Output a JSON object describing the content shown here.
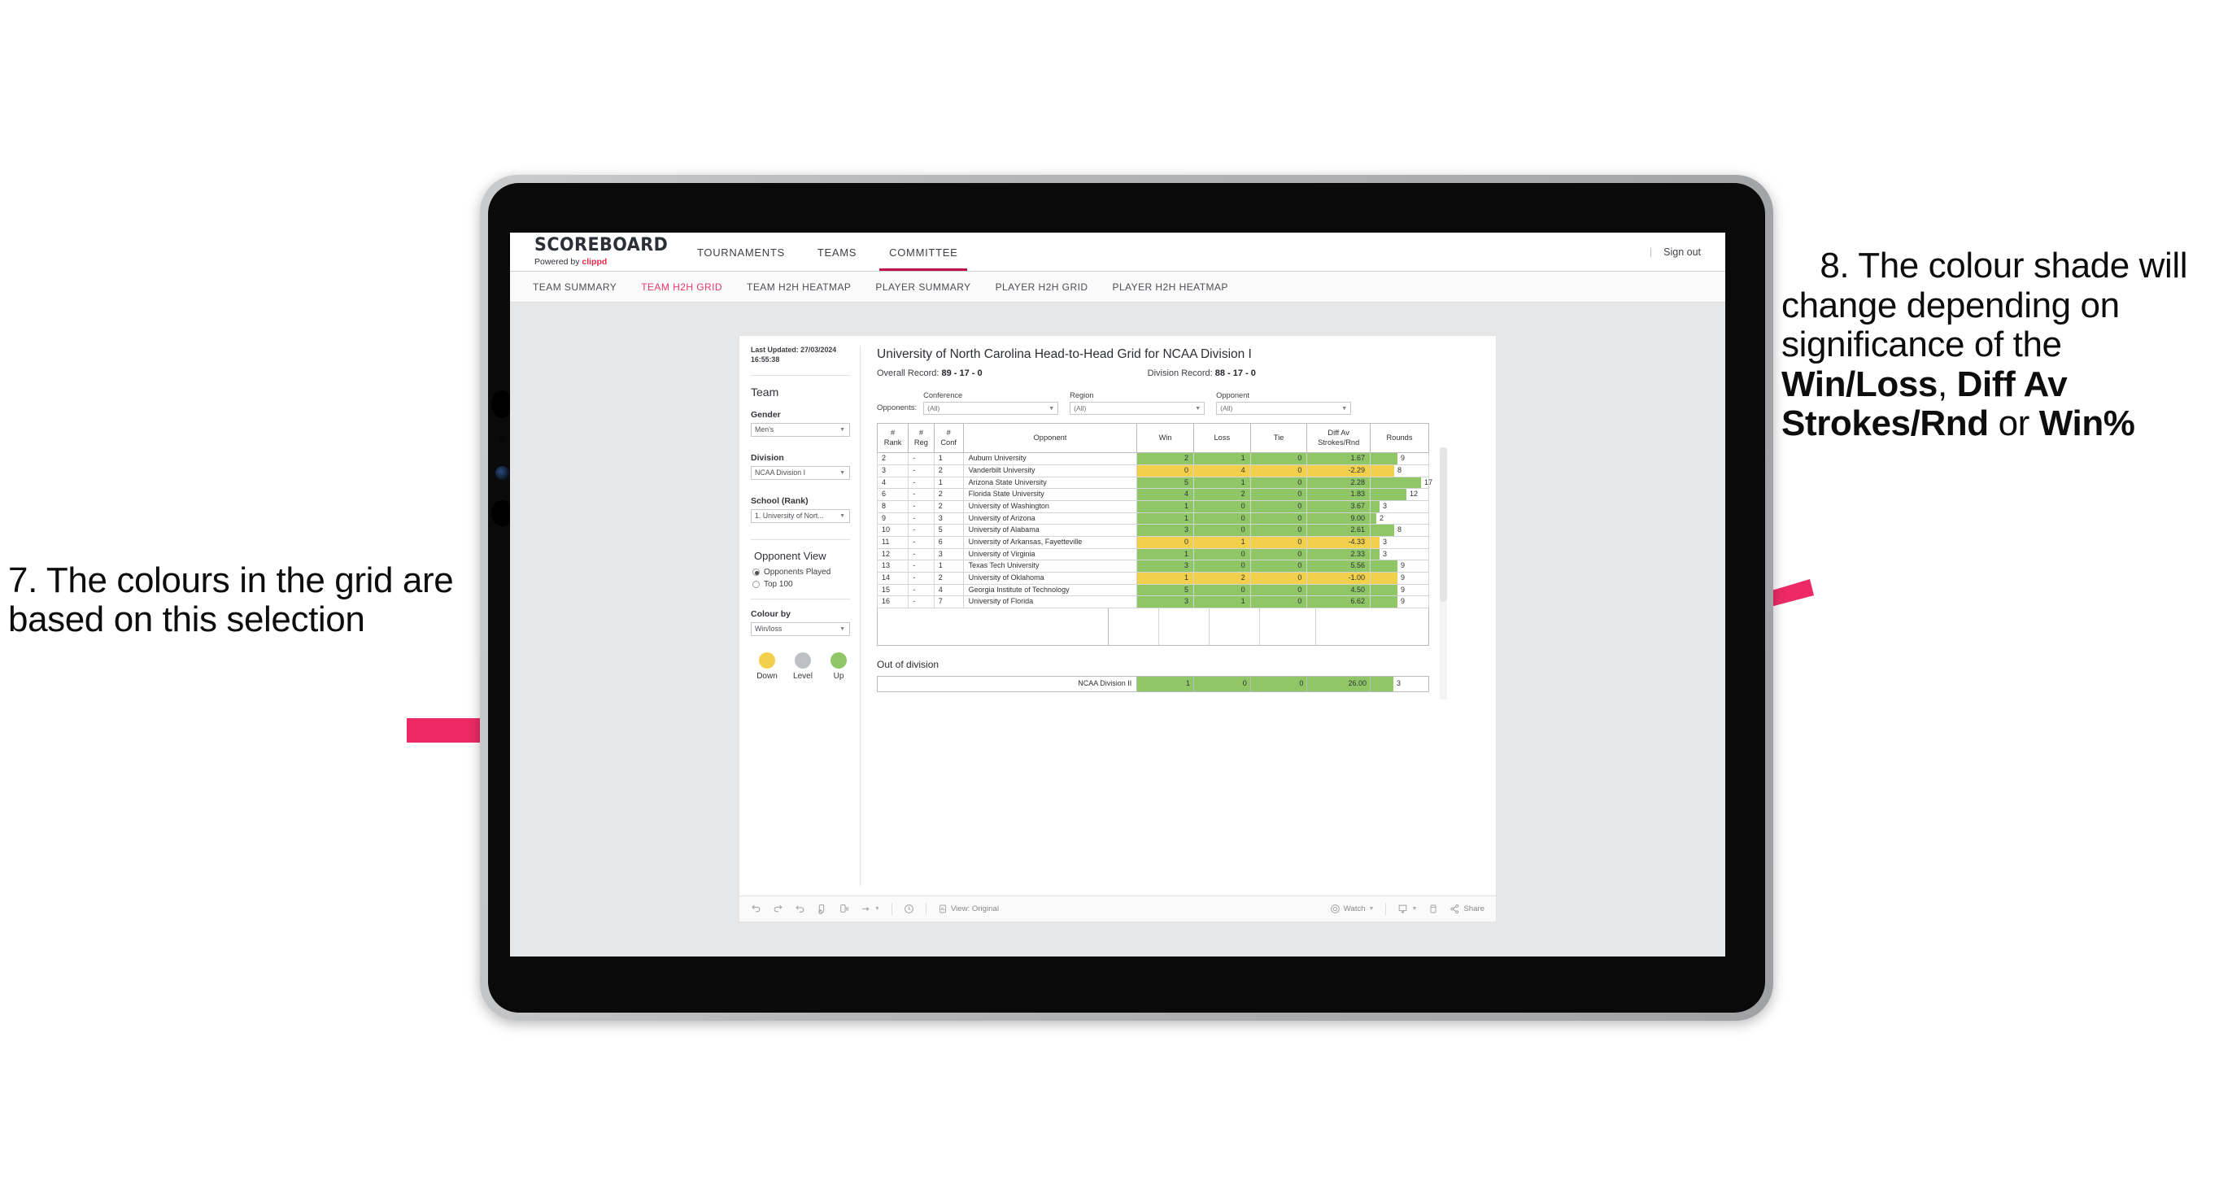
{
  "annotations": {
    "left": "7. The colours in the grid are based on this selection",
    "right_pre": "8. The colour shade will change depending on significance of the ",
    "right_b1": "Win/Loss",
    "right_mid1": ", ",
    "right_b2": "Diff Av Strokes/Rnd",
    "right_mid2": " or ",
    "right_b3": "Win%",
    "arrow_color": "#ED2A66"
  },
  "topnav": {
    "brand_word": "SCOREBOARD",
    "brand_powered": "Powered by ",
    "brand_accent": "clippd",
    "items": [
      {
        "label": "TOURNAMENTS",
        "active": false
      },
      {
        "label": "TEAMS",
        "active": false
      },
      {
        "label": "COMMITTEE",
        "active": true
      }
    ],
    "signout": "Sign out",
    "divider": "|"
  },
  "subnav": {
    "items": [
      {
        "label": "TEAM SUMMARY",
        "active": false
      },
      {
        "label": "TEAM H2H GRID",
        "active": true
      },
      {
        "label": "TEAM H2H HEATMAP",
        "active": false
      },
      {
        "label": "PLAYER SUMMARY",
        "active": false
      },
      {
        "label": "PLAYER H2H GRID",
        "active": false
      },
      {
        "label": "PLAYER H2H HEATMAP",
        "active": false
      }
    ]
  },
  "sidebar": {
    "last_updated": "Last Updated: 27/03/2024 16:55:38",
    "team_heading": "Team",
    "gender_label": "Gender",
    "gender_value": "Men's",
    "division_label": "Division",
    "division_value": "NCAA Division I",
    "school_label": "School (Rank)",
    "school_value": "1. University of Nort...",
    "opponent_view_heading": "Opponent View",
    "opt_opponents_played": "Opponents Played",
    "opt_top100": "Top 100",
    "colour_by_label": "Colour by",
    "colour_by_value": "Win/loss",
    "legend": [
      {
        "label": "Down",
        "color": "#F2D04B"
      },
      {
        "label": "Level",
        "color": "#BDC0C4"
      },
      {
        "label": "Up",
        "color": "#8FC766"
      }
    ]
  },
  "main": {
    "title": "University of North Carolina Head-to-Head Grid for NCAA Division I",
    "overall_record_label": "Overall Record: ",
    "overall_record_value": "89 - 17 - 0",
    "division_record_label": "Division Record: ",
    "division_record_value": "88 - 17 - 0",
    "opponents_label": "Opponents:",
    "filters": [
      {
        "label": "Conference",
        "value": "(All)"
      },
      {
        "label": "Region",
        "value": "(All)"
      },
      {
        "label": "Opponent",
        "value": "(All)"
      }
    ],
    "columns": [
      "#\nRank",
      "#\nReg",
      "#\nConf",
      "Opponent",
      "Win",
      "Loss",
      "Tie",
      "Diff Av\nStrokes/Rnd",
      "Rounds"
    ],
    "out_of_division_heading": "Out of division",
    "out_of_division_row": {
      "name": "NCAA Division II",
      "win": "1",
      "loss": "0",
      "tie": "0",
      "diff": "26.00",
      "rounds": "3",
      "color": "green"
    }
  },
  "chart_data": {
    "type": "table",
    "title": "University of North Carolina Head-to-Head Grid for NCAA Division I",
    "columns": [
      "#Rank",
      "#Reg",
      "#Conf",
      "Opponent",
      "Win",
      "Loss",
      "Tie",
      "Diff Av Strokes/Rnd",
      "Rounds"
    ],
    "rounds_max": 17,
    "rows": [
      {
        "rank": "2",
        "reg": "-",
        "conf": "1",
        "opponent": "Auburn University",
        "win": "2",
        "loss": "1",
        "tie": "0",
        "diff": "1.67",
        "rounds": "9",
        "rounds_n": 9,
        "color": "green"
      },
      {
        "rank": "3",
        "reg": "-",
        "conf": "2",
        "opponent": "Vanderbilt University",
        "win": "0",
        "loss": "4",
        "tie": "0",
        "diff": "-2.29",
        "rounds": "8",
        "rounds_n": 8,
        "color": "yellow"
      },
      {
        "rank": "4",
        "reg": "-",
        "conf": "1",
        "opponent": "Arizona State University",
        "win": "5",
        "loss": "1",
        "tie": "0",
        "diff": "2.28",
        "rounds": "17",
        "rounds_n": 17,
        "color": "green"
      },
      {
        "rank": "6",
        "reg": "-",
        "conf": "2",
        "opponent": "Florida State University",
        "win": "4",
        "loss": "2",
        "tie": "0",
        "diff": "1.83",
        "rounds": "12",
        "rounds_n": 12,
        "color": "green"
      },
      {
        "rank": "8",
        "reg": "-",
        "conf": "2",
        "opponent": "University of Washington",
        "win": "1",
        "loss": "0",
        "tie": "0",
        "diff": "3.67",
        "rounds": "3",
        "rounds_n": 3,
        "color": "green"
      },
      {
        "rank": "9",
        "reg": "-",
        "conf": "3",
        "opponent": "University of Arizona",
        "win": "1",
        "loss": "0",
        "tie": "0",
        "diff": "9.00",
        "rounds": "2",
        "rounds_n": 2,
        "color": "green"
      },
      {
        "rank": "10",
        "reg": "-",
        "conf": "5",
        "opponent": "University of Alabama",
        "win": "3",
        "loss": "0",
        "tie": "0",
        "diff": "2.61",
        "rounds": "8",
        "rounds_n": 8,
        "color": "green"
      },
      {
        "rank": "11",
        "reg": "-",
        "conf": "6",
        "opponent": "University of Arkansas, Fayetteville",
        "win": "0",
        "loss": "1",
        "tie": "0",
        "diff": "-4.33",
        "rounds": "3",
        "rounds_n": 3,
        "color": "yellow"
      },
      {
        "rank": "12",
        "reg": "-",
        "conf": "3",
        "opponent": "University of Virginia",
        "win": "1",
        "loss": "0",
        "tie": "0",
        "diff": "2.33",
        "rounds": "3",
        "rounds_n": 3,
        "color": "green"
      },
      {
        "rank": "13",
        "reg": "-",
        "conf": "1",
        "opponent": "Texas Tech University",
        "win": "3",
        "loss": "0",
        "tie": "0",
        "diff": "5.56",
        "rounds": "9",
        "rounds_n": 9,
        "color": "green"
      },
      {
        "rank": "14",
        "reg": "-",
        "conf": "2",
        "opponent": "University of Oklahoma",
        "win": "1",
        "loss": "2",
        "tie": "0",
        "diff": "-1.00",
        "rounds": "9",
        "rounds_n": 9,
        "color": "yellow"
      },
      {
        "rank": "15",
        "reg": "-",
        "conf": "4",
        "opponent": "Georgia Institute of Technology",
        "win": "5",
        "loss": "0",
        "tie": "0",
        "diff": "4.50",
        "rounds": "9",
        "rounds_n": 9,
        "color": "green"
      },
      {
        "rank": "16",
        "reg": "-",
        "conf": "7",
        "opponent": "University of Florida",
        "win": "3",
        "loss": "1",
        "tie": "0",
        "diff": "6.62",
        "rounds": "9",
        "rounds_n": 9,
        "color": "green"
      }
    ]
  },
  "toolbar": {
    "undo": "undo-icon",
    "redo": "redo-icon",
    "revert": "revert-icon",
    "refresh": "refresh-data-icon",
    "pause": "pause-updates-icon",
    "alerts": "alerts-icon",
    "clock": "clock-icon",
    "view_label": "View: Original",
    "watch_label": "Watch",
    "download_label": "download-icon",
    "device_label": "device-layout-icon",
    "share_label": "Share"
  }
}
